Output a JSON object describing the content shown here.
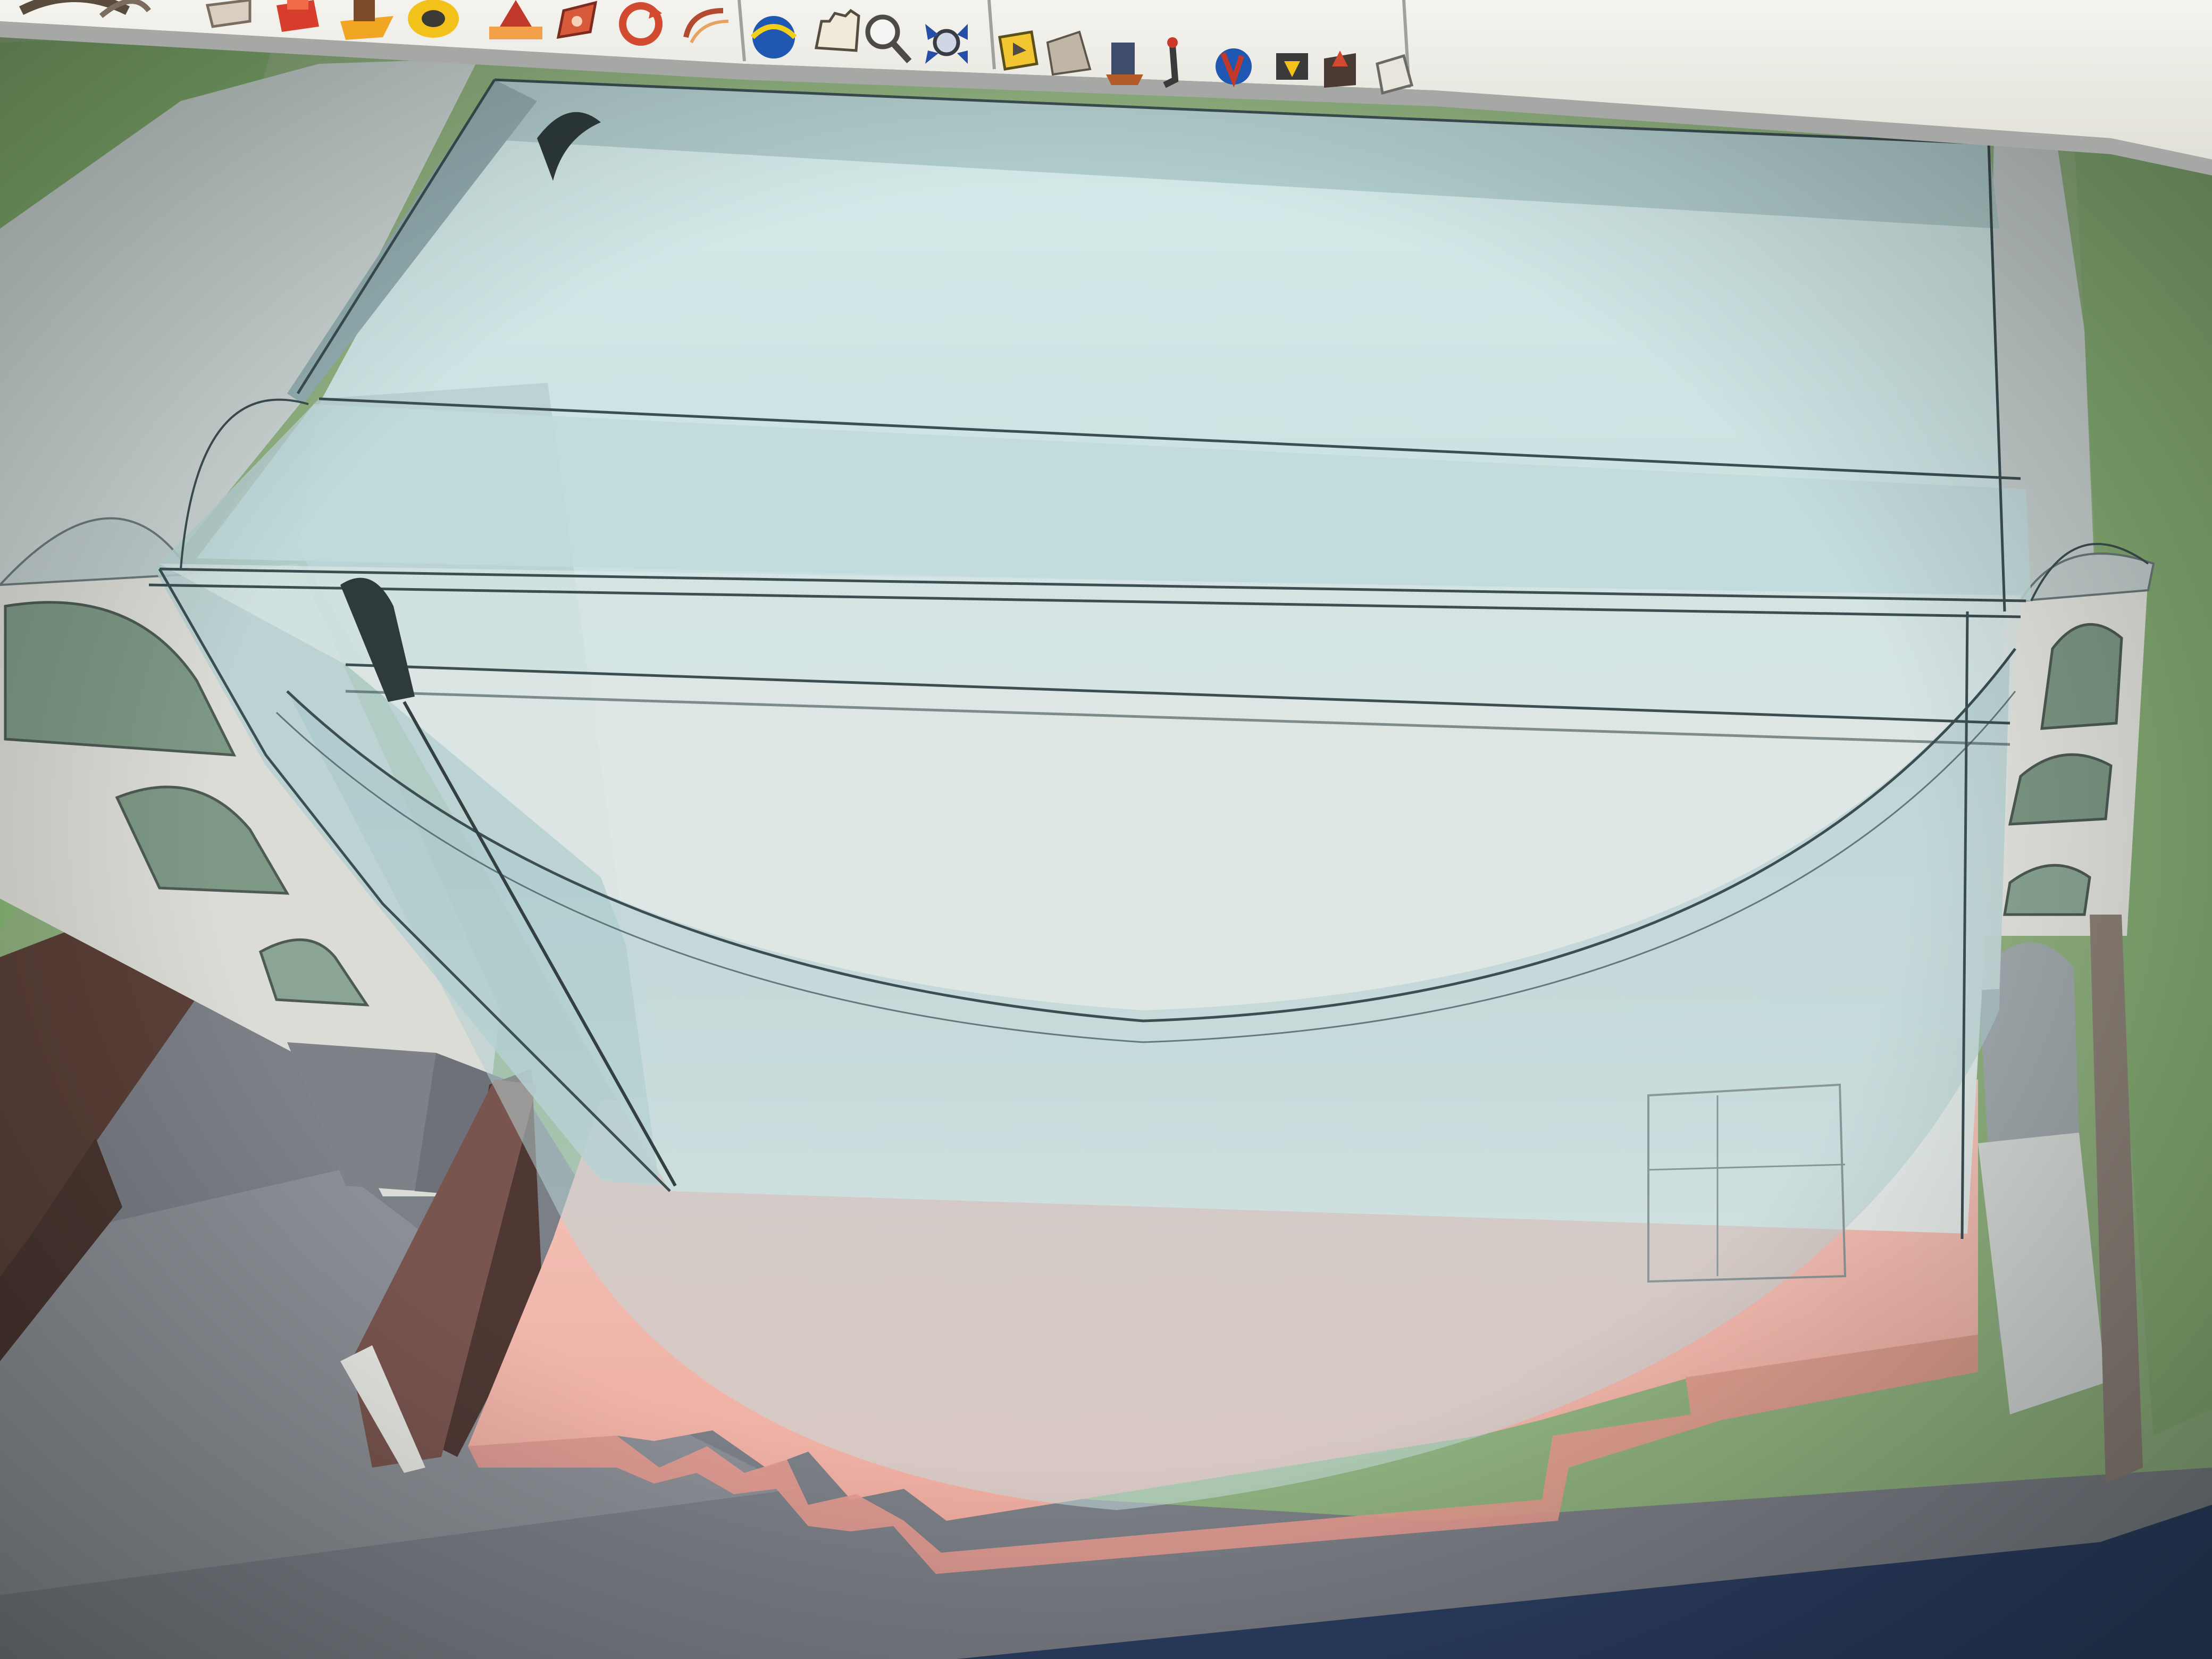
{
  "app": {
    "name": "",
    "screen_type": "3d-modeling-viewport-photographed-monitor"
  },
  "toolbar": {
    "items": [
      {
        "icon": "arc-icon"
      },
      {
        "icon": "eraser-icon"
      },
      {
        "icon": "paint-bucket-icon"
      },
      {
        "icon": "push-pull-icon"
      },
      {
        "icon": "follow-me-icon"
      },
      {
        "icon": "move-icon"
      },
      {
        "icon": "scale-icon"
      },
      {
        "icon": "rotate-icon"
      },
      {
        "icon": "offset-icon"
      },
      {
        "icon": "orbit-icon"
      },
      {
        "icon": "pan-icon"
      },
      {
        "icon": "zoom-icon"
      },
      {
        "icon": "zoom-extents-icon"
      },
      {
        "icon": "tape-measure-icon"
      },
      {
        "icon": "section-plane-icon"
      },
      {
        "icon": "position-camera-icon"
      },
      {
        "icon": "walk-icon"
      },
      {
        "icon": "look-around-icon"
      },
      {
        "icon": "get-models-icon"
      },
      {
        "icon": "share-model-icon"
      },
      {
        "icon": "extension-warehouse-icon"
      }
    ]
  },
  "colors": {
    "toolbar_background": "#ecebe4",
    "glass_tint": "#bcd6d8",
    "floor": "#f1b8ad",
    "grass": "#79a868",
    "stone": "#d7d8d5",
    "window": "#7d9885",
    "ground": "#7b7f86",
    "desk_frame": "#2f4570"
  }
}
